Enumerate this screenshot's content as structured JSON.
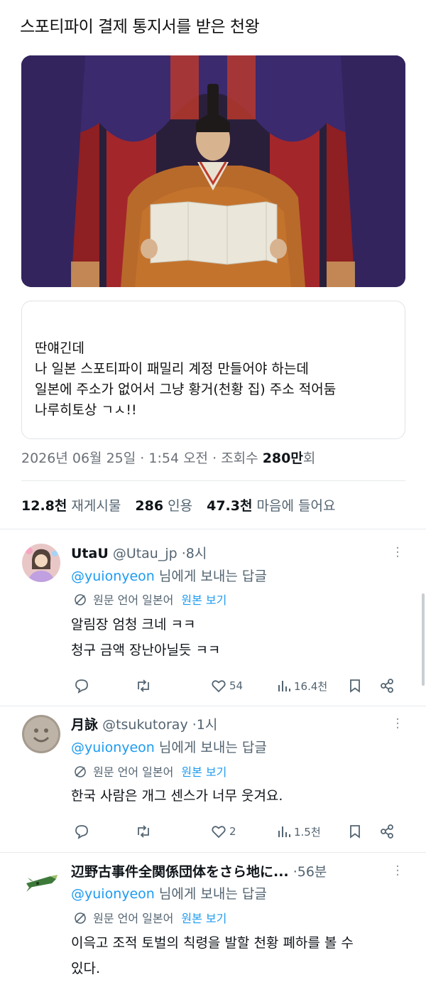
{
  "post": {
    "headline": "스포티파이 결제 통지서를 받은 천왕",
    "quote_lines": [
      "딴얘긴데",
      "나 일본 스포티파이 패밀리 계정 만들어야 하는데",
      "일본에 주소가 없어서 그냥 황거(천황 집) 주소 적어둠",
      "나루히토상 ㄱㅅ!!"
    ],
    "meta": {
      "date": "2026년 06월 25일",
      "time": "1:54 오전",
      "views_label": "조회수",
      "views_value": "280만",
      "views_unit": "회",
      "sep": "·"
    },
    "stats": {
      "reposts_value": "12.8천",
      "reposts_label": "재게시물",
      "quotes_value": "286",
      "quotes_label": "인용",
      "likes_value": "47.3천",
      "likes_label": "마음에 들어요"
    }
  },
  "replies": [
    {
      "name": "UtaU",
      "handle": "@Utau_jp",
      "time": "8시",
      "reply_to_handle": "@yuionyeon",
      "reply_to_suffix": "님에게 보내는 답글",
      "translation_label": "원문 언어 일본어",
      "translation_link": "원본 보기",
      "body": [
        "알림장 엄청 크네 ㅋㅋ",
        "청구 금액 장난아닐듯 ㅋㅋ"
      ],
      "likes": "54",
      "views": "16.4천"
    },
    {
      "name": "月詠",
      "handle": "@tsukutoray",
      "time": "1시",
      "reply_to_handle": "@yuionyeon",
      "reply_to_suffix": "님에게 보내는 답글",
      "translation_label": "원문 언어 일본어",
      "translation_link": "원본 보기",
      "body": [
        "한국 사람은 개그 센스가 너무 웃겨요."
      ],
      "likes": "2",
      "views": "1.5천"
    },
    {
      "name": "辺野古事件全関係団体をさら地に...",
      "time": "56분",
      "reply_to_handle": "@yuionyeon",
      "reply_to_suffix": "님에게 보내는 답글",
      "translation_label": "원문 언어 일본어",
      "translation_link": "원본 보기",
      "body": [
        "이윽고 조적 토벌의 칙령을 발할 천황 폐하를 볼 수",
        "있다."
      ]
    }
  ],
  "colors": {
    "link": "#1d9bf0",
    "muted": "#536471",
    "text": "#0f1419",
    "border": "#dfe3e7"
  },
  "icons": [
    "reply-icon",
    "repost-icon",
    "like-icon",
    "views-icon",
    "bookmark-icon",
    "share-icon",
    "more-icon",
    "translate-icon"
  ]
}
